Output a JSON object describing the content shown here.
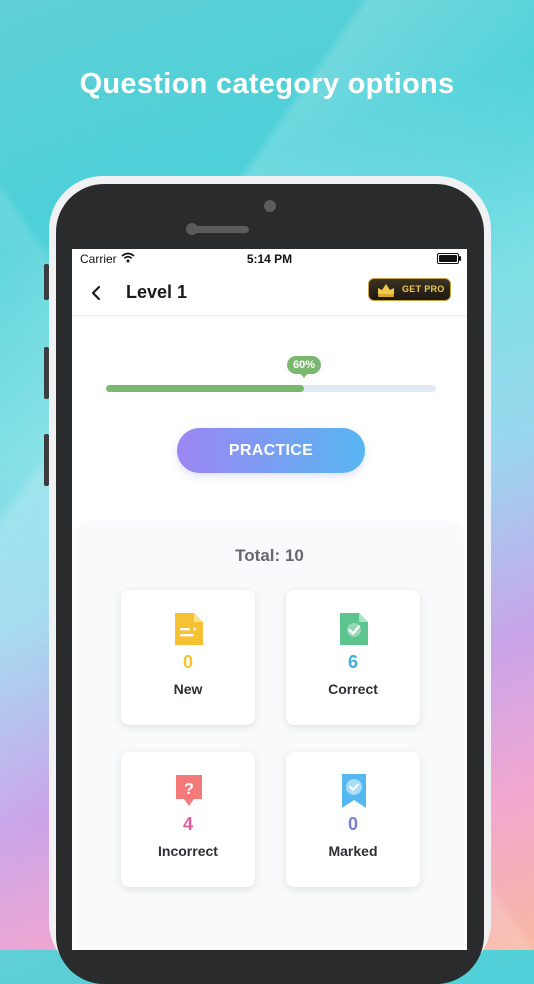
{
  "headline": "Question category options",
  "status": {
    "carrier": "Carrier",
    "time": "5:14 PM"
  },
  "nav": {
    "title": "Level 1",
    "pro_label": "GET PRO"
  },
  "progress": {
    "percent": 60,
    "label": "60%"
  },
  "practice_label": "PRACTICE",
  "total": {
    "label": "Total:",
    "value": "10"
  },
  "cards": [
    {
      "label": "New",
      "count": "0",
      "color": "#f6c233",
      "icon": "document-icon"
    },
    {
      "label": "Correct",
      "count": "6",
      "color": "#3fb0d8",
      "icon": "checked-document-icon"
    },
    {
      "label": "Incorrect",
      "count": "4",
      "color": "#ec5a9a",
      "icon": "question-bubble-icon"
    },
    {
      "label": "Marked",
      "count": "0",
      "color": "#7b7fd8",
      "icon": "bookmark-check-icon"
    }
  ],
  "colors": {
    "progress": "#7bb86f",
    "progress_track": "#e3e9f4",
    "practice_start": "#9c86f3",
    "practice_end": "#58b6f2",
    "pro_gold": "#f2c94c"
  }
}
